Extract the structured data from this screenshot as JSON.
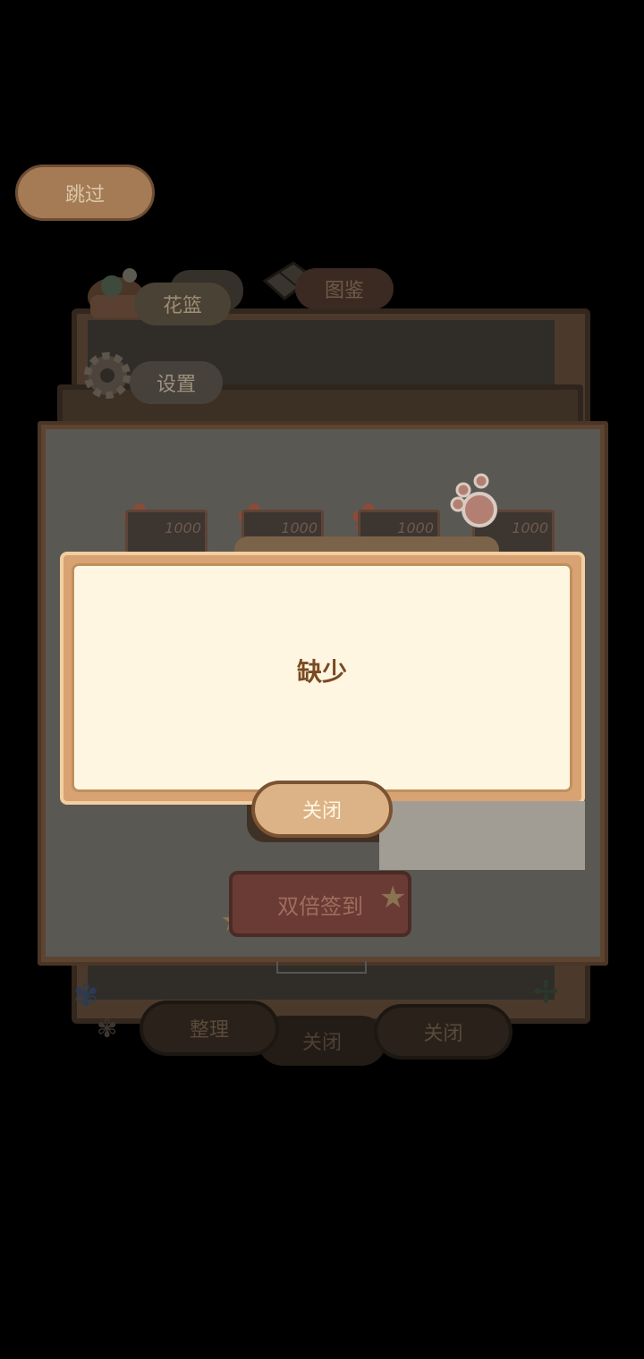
{
  "skip": {
    "label": "跳过"
  },
  "tabs": {
    "basket": "花篮",
    "atlas": "图鉴",
    "settings": "设置"
  },
  "rewards": [
    {
      "value": "1000"
    },
    {
      "value": "1000"
    },
    {
      "value": "1000"
    },
    {
      "value": "1000"
    }
  ],
  "dialog": {
    "message": "缺少",
    "close_label": "关闭"
  },
  "sign_in": {
    "label": "双倍签到"
  },
  "bottom": {
    "sort_label": "整理",
    "close_center_label": "关闭",
    "close_right_label": "关闭"
  },
  "colors": {
    "dialog_bg": "#fff6e1",
    "dialog_border": "#d8a272",
    "message_text": "#7a4a22",
    "button_fill": "#dcb386",
    "overlay": "#000000"
  },
  "icons": [
    "basket-icon",
    "book-icon",
    "gear-icon",
    "flower-icon",
    "paw-icon",
    "star-icon",
    "butterfly-icon",
    "dragonfly-icon"
  ]
}
